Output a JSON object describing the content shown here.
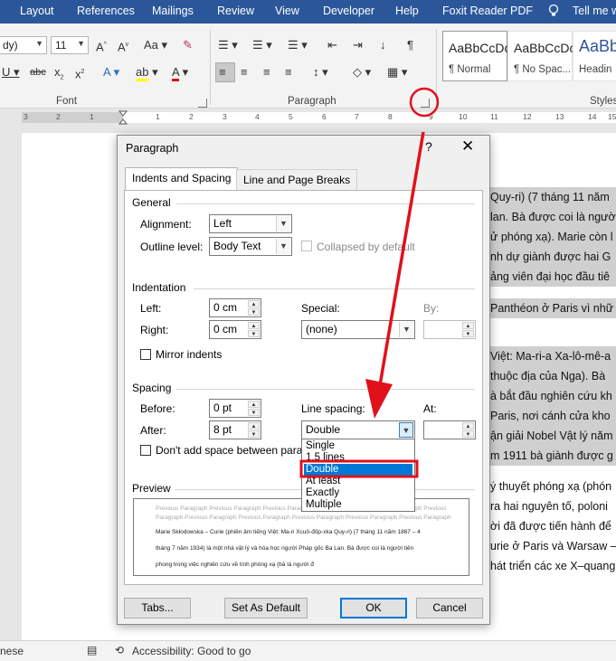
{
  "ribbon": {
    "tabs": [
      "Layout",
      "References",
      "Mailings",
      "Review",
      "View",
      "Developer",
      "Help",
      "Foxit Reader PDF",
      "Tell me w"
    ],
    "font_name": "dy)",
    "font_size": "11",
    "groups": {
      "font": "Font",
      "paragraph": "Paragraph",
      "styles": "Styles"
    },
    "styles": [
      {
        "sample": "AaBbCcDc",
        "name": "¶ Normal"
      },
      {
        "sample": "AaBbCcDc",
        "name": "¶ No Spac..."
      },
      {
        "sample": "AaBb",
        "name": "Headin"
      }
    ]
  },
  "ruler": {
    "ticks": [
      "3",
      "2",
      "1",
      "1",
      "2",
      "3",
      "4",
      "5",
      "6",
      "7",
      "8",
      "9",
      "10",
      "11",
      "12",
      "13",
      "14",
      "15"
    ]
  },
  "document": {
    "lines": [
      "Quy-ri) (7 tháng 11 năm",
      "lan. Bà được coi là người",
      "ử phóng xạ). Marie còn l",
      "nh dự giành được hai G",
      "ảng viên đại học đầu tiê",
      "Panthéon ở Paris vì nhữ",
      "Việt: Ma-ri-a Xa-lô-mê-a",
      "thuộc địa của Nga). Bà",
      "à bắt đầu nghiên cứu kh",
      "Paris, nơi cánh cửa kho",
      "ận giải Nobel Vật lý năm",
      "m 1911 bà giành được g",
      "ý thuyết phóng xạ (phón",
      "ra hai nguyên tố, poloni",
      "ời đã được tiến hành để",
      "urie ở Paris và Warsaw –",
      "hát triển các xe X–quang"
    ]
  },
  "dialog": {
    "title": "Paragraph",
    "help": "?",
    "close": "✕",
    "tabs": {
      "indents": "Indents and Spacing",
      "breaks": "Line and Page Breaks"
    },
    "general": {
      "heading": "General",
      "alignment_label": "Alignment:",
      "alignment_value": "Left",
      "outline_label": "Outline level:",
      "outline_value": "Body Text",
      "collapsed_label": "Collapsed by default"
    },
    "indentation": {
      "heading": "Indentation",
      "left_label": "Left:",
      "left_value": "0 cm",
      "right_label": "Right:",
      "right_value": "0 cm",
      "special_label": "Special:",
      "special_value": "(none)",
      "by_label": "By:",
      "mirror_label": "Mirror indents"
    },
    "spacing": {
      "heading": "Spacing",
      "before_label": "Before:",
      "before_value": "0 pt",
      "after_label": "After:",
      "after_value": "8 pt",
      "line_spacing_label": "Line spacing:",
      "line_spacing_value": "Double",
      "at_label": "At:",
      "dont_add_label": "Don't add space between parag",
      "options": [
        "Single",
        "1.5 lines",
        "Double",
        "At least",
        "Exactly",
        "Multiple"
      ],
      "selected_index": 2
    },
    "preview": {
      "heading": "Preview",
      "grey_lines": [
        "Previous Paragraph Previous Paragraph Previous Paragraph Previous Paragraph Previous Paragraph Previous",
        "Paragraph Previous Paragraph Previous Paragraph Previous Paragraph Previous Paragraph Previous Paragraph"
      ],
      "text_lines": [
        "Marie Skłodowska – Curie (phiên âm tiếng Việt: Ma-ri Xcuô-đốp-xka Quy-ri) (7 tháng 11 năm 1867 – 4",
        "tháng 7 năm 1934) là một nhà vật lý và hóa học người Pháp gốc Ba Lan. Bà được coi là người tiên",
        "phong trong việc nghiên cứu về tính phóng xạ  (bà là người đ"
      ]
    },
    "buttons": {
      "tabs": "Tabs...",
      "default": "Set As Default",
      "ok": "OK",
      "cancel": "Cancel"
    }
  },
  "statusbar": {
    "language": "nese",
    "accessibility": "Accessibility: Good to go"
  },
  "colors": {
    "ribbon_blue": "#2b579a",
    "annotation_red": "#e0111b",
    "selection_blue": "#0078d7"
  }
}
